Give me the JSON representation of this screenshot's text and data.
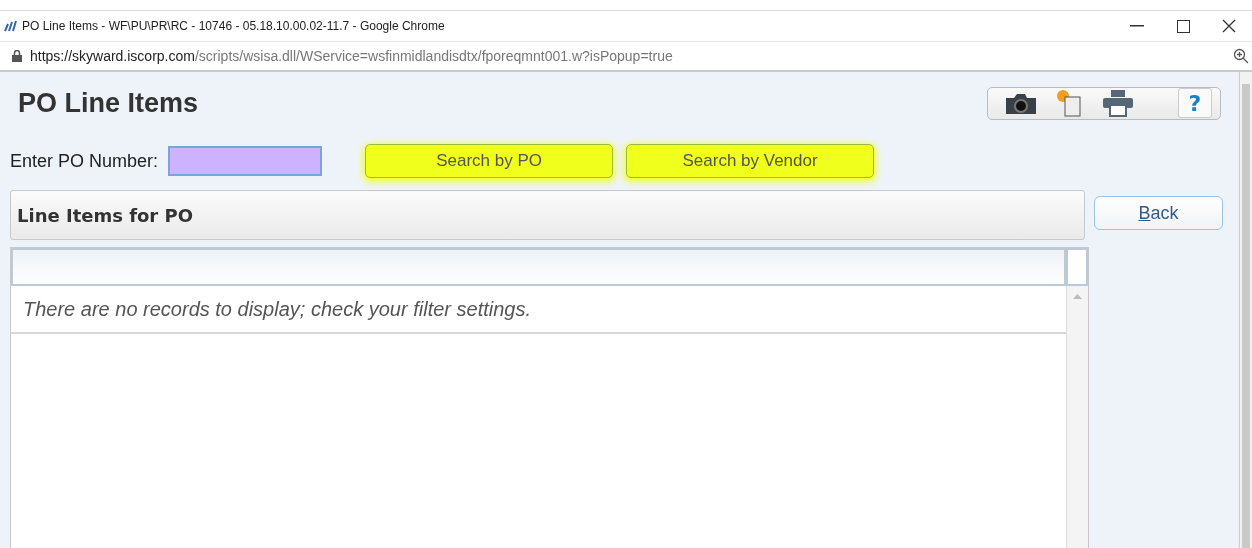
{
  "window": {
    "title": "PO Line Items - WF\\PU\\PR\\RC - 10746 - 05.18.10.00.02-11.7 - Google Chrome"
  },
  "address_bar": {
    "host": "https://skyward.iscorp.com",
    "path": "/scripts/wsisa.dll/WService=wsfinmidlandisdtx/fporeqmnt001.w?isPopup=true"
  },
  "page": {
    "title": "PO Line Items",
    "help_button": "?"
  },
  "search": {
    "label": "Enter PO Number:",
    "buttons": [
      {
        "label": "Search by PO"
      },
      {
        "label": "Search by Vendor"
      }
    ]
  },
  "section": {
    "title": "Line Items for PO",
    "back_button": "Back"
  },
  "grid": {
    "empty_message": "There are no records to display; check your filter settings."
  }
}
